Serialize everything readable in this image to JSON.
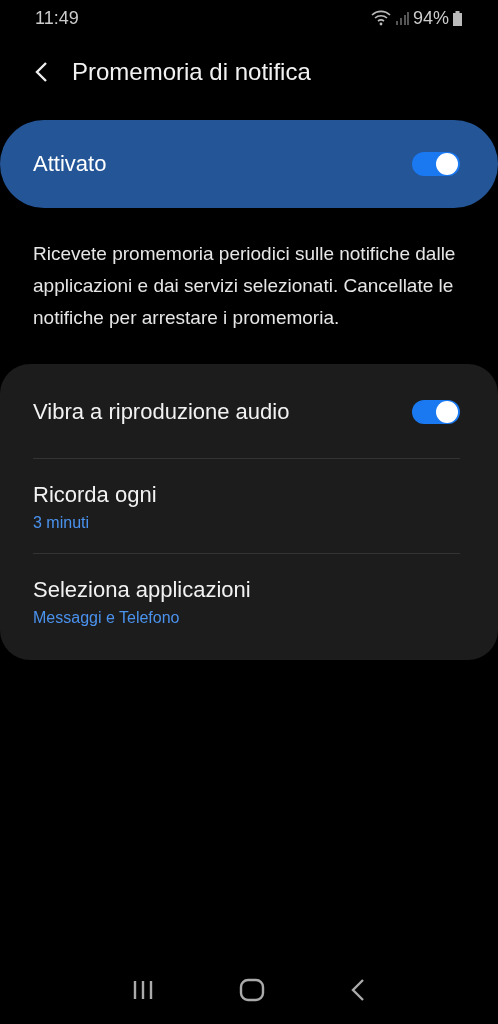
{
  "status_bar": {
    "time": "11:49",
    "battery": "94%"
  },
  "header": {
    "title": "Promemoria di notifica"
  },
  "master": {
    "label": "Attivato",
    "on": true
  },
  "description": "Ricevete promemoria periodici sulle notifiche dalle applicazioni e dai servizi selezionati. Cancellate le notifiche per arrestare i promemoria.",
  "settings": [
    {
      "kind": "switch",
      "label": "Vibra a riproduzione audio",
      "on": true
    },
    {
      "kind": "value",
      "label": "Ricorda ogni",
      "value": "3 minuti"
    },
    {
      "kind": "value",
      "label": "Seleziona applicazioni",
      "value": "Messaggi e Telefono"
    }
  ]
}
